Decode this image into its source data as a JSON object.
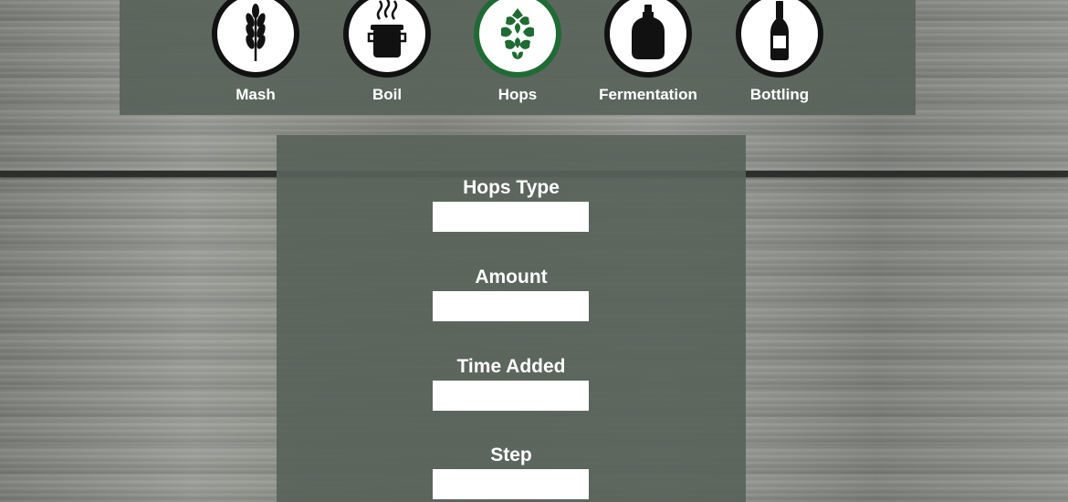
{
  "nav": {
    "items": [
      {
        "label": "Mash",
        "icon": "wheat-icon"
      },
      {
        "label": "Boil",
        "icon": "pot-icon"
      },
      {
        "label": "Hops",
        "icon": "hop-icon"
      },
      {
        "label": "Fermentation",
        "icon": "carboy-icon"
      },
      {
        "label": "Bottling",
        "icon": "bottle-icon"
      }
    ],
    "active": "Hops",
    "active_color": "#1f6b33"
  },
  "form": {
    "fields": [
      {
        "label": "Hops Type",
        "value": ""
      },
      {
        "label": "Amount",
        "value": ""
      },
      {
        "label": "Time Added",
        "value": ""
      },
      {
        "label": "Step",
        "value": ""
      }
    ]
  }
}
